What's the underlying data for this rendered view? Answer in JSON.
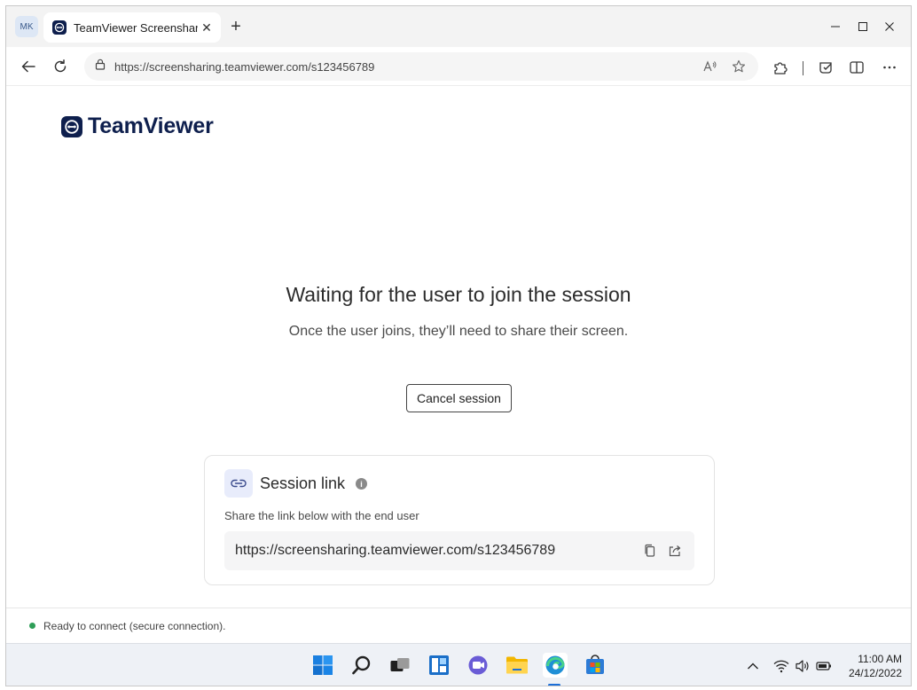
{
  "browser": {
    "profile_initials": "MK",
    "tab_title": "TeamViewer Screenshar",
    "tab_close": "✕",
    "new_tab": "+",
    "minimize": "—",
    "maximize": "☐",
    "close": "✕",
    "url": "https://screensharing.teamviewer.com/s123456789",
    "read_aloud": "A̅"
  },
  "page": {
    "logo_text": "TeamViewer",
    "heading": "Waiting for the user to join the session",
    "subheading": "Once the user joins, they’ll need to share their screen.",
    "cancel_label": "Cancel session",
    "card": {
      "title": "Session link",
      "info_glyph": "i",
      "description": "Share the link below with the end user",
      "link": "https://screensharing.teamviewer.com/s123456789"
    }
  },
  "status": {
    "text": "Ready to connect (secure connection).",
    "color": "#2e9e57"
  },
  "taskbar": {
    "time": "11:00 AM",
    "date": "24/12/2022",
    "apps": [
      "start-icon",
      "search-icon",
      "task-view-icon",
      "widgets-icon",
      "teams-chat-icon",
      "file-explorer-icon",
      "edge-icon",
      "store-icon"
    ]
  },
  "colors": {
    "brand_navy": "#0e1f4d",
    "accent_blue": "#1d6fd8"
  }
}
